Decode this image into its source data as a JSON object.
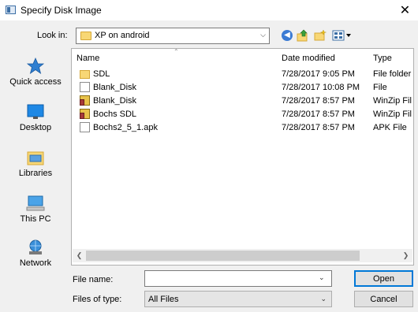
{
  "window": {
    "title": "Specify Disk Image",
    "close_glyph": "✕"
  },
  "lookin": {
    "label": "Look in:",
    "value": "XP on android"
  },
  "toolbar": {
    "back_glyph": "◀",
    "up_glyph": "⇧",
    "newfolder_glyph": "✸",
    "views_glyph": "▦▾"
  },
  "places": [
    {
      "label": "Quick access",
      "icon": "star-icon"
    },
    {
      "label": "Desktop",
      "icon": "desktop-icon"
    },
    {
      "label": "Libraries",
      "icon": "libraries-icon"
    },
    {
      "label": "This PC",
      "icon": "computer-icon"
    },
    {
      "label": "Network",
      "icon": "network-icon"
    }
  ],
  "columns": {
    "name": "Name",
    "date": "Date modified",
    "type": "Type"
  },
  "files": [
    {
      "name": "SDL",
      "date": "7/28/2017 9:05 PM",
      "type": "File folder",
      "icon": "folder-icon"
    },
    {
      "name": "Blank_Disk",
      "date": "7/28/2017 10:08 PM",
      "type": "File",
      "icon": "file-icon"
    },
    {
      "name": "Blank_Disk",
      "date": "7/28/2017 8:57 PM",
      "type": "WinZip Fil",
      "icon": "zip-icon"
    },
    {
      "name": "Bochs SDL",
      "date": "7/28/2017 8:57 PM",
      "type": "WinZip Fil",
      "icon": "zip-icon"
    },
    {
      "name": "Bochs2_5_1.apk",
      "date": "7/28/2017 8:57 PM",
      "type": "APK File",
      "icon": "file-icon"
    }
  ],
  "filename": {
    "label": "File name:",
    "value": ""
  },
  "filetype": {
    "label": "Files of type:",
    "value": "All Files"
  },
  "buttons": {
    "open": "Open",
    "cancel": "Cancel"
  }
}
